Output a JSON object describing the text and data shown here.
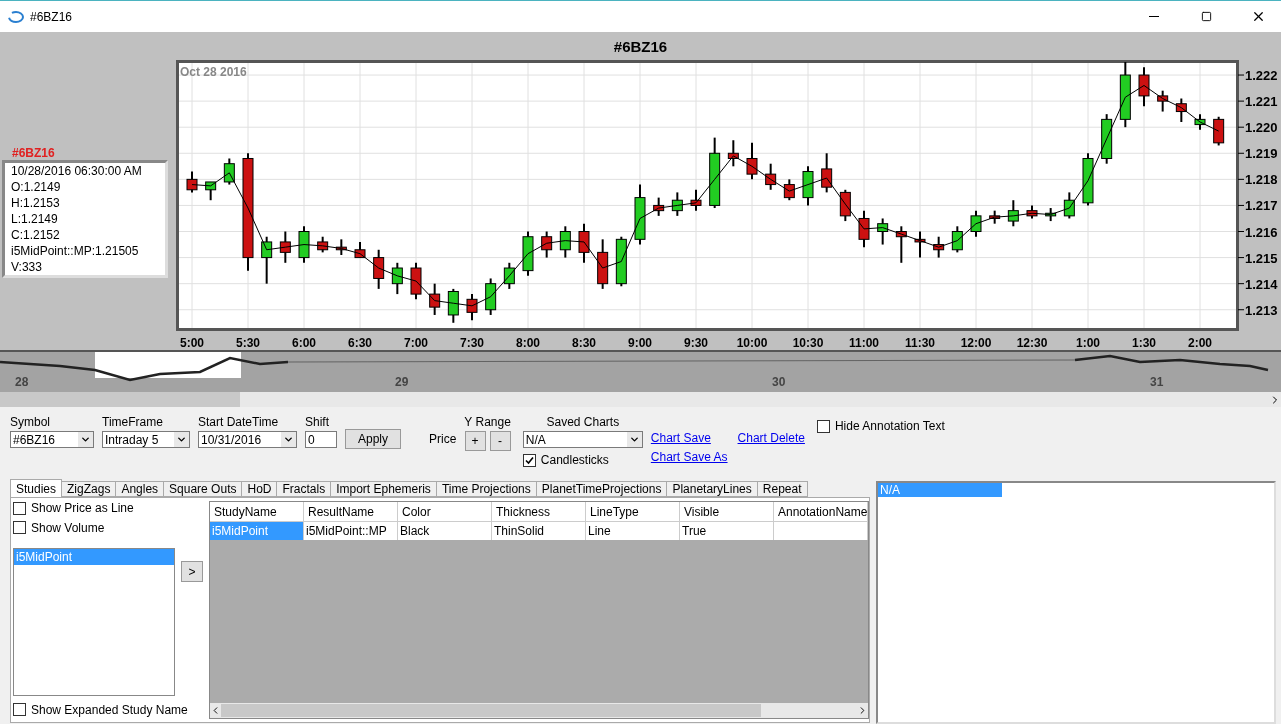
{
  "window": {
    "title": "#6BZ16"
  },
  "chart": {
    "title": "#6BZ16",
    "date_label": "Oct 28 2016",
    "info": {
      "symbol": "#6BZ16",
      "lines": [
        "10/28/2016 06:30:00 AM",
        "O:1.2149",
        "H:1.2153",
        "L:1.2149",
        "C:1.2152",
        "i5MidPoint::MP:1.21505",
        "V:333"
      ]
    },
    "chart_data": {
      "type": "candlestick",
      "grid": true,
      "categories": [
        "5:00",
        null,
        null,
        "5:30",
        null,
        null,
        "6:00",
        null,
        null,
        "6:30",
        null,
        null,
        "7:00",
        null,
        null,
        "7:30",
        null,
        null,
        "8:00",
        null,
        null,
        "8:30",
        null,
        null,
        "9:00",
        null,
        null,
        "9:30",
        null,
        null,
        "10:00",
        null,
        null,
        "10:30",
        null,
        null,
        "11:00",
        null,
        null,
        "11:30",
        null,
        null,
        "12:00",
        null,
        null,
        "12:30",
        null,
        null,
        "1:00",
        null,
        null,
        "1:30",
        null,
        null,
        "2:00",
        null
      ],
      "ohlc": [
        [
          1.218,
          1.2183,
          1.2175,
          1.2176
        ],
        [
          1.2176,
          1.2179,
          1.2172,
          1.2179
        ],
        [
          1.2179,
          1.2188,
          1.2178,
          1.2186
        ],
        [
          1.2188,
          1.219,
          1.2145,
          1.215
        ],
        [
          1.215,
          1.2158,
          1.214,
          1.2156
        ],
        [
          1.2156,
          1.216,
          1.2148,
          1.2152
        ],
        [
          1.215,
          1.2162,
          1.2148,
          1.216
        ],
        [
          1.2156,
          1.2158,
          1.2152,
          1.2153
        ],
        [
          1.2154,
          1.2157,
          1.2151,
          1.2153
        ],
        [
          1.2153,
          1.2156,
          1.215,
          1.215
        ],
        [
          1.215,
          1.2153,
          1.2138,
          1.2142
        ],
        [
          1.214,
          1.2148,
          1.2136,
          1.2146
        ],
        [
          1.2146,
          1.2148,
          1.2134,
          1.2136
        ],
        [
          1.2136,
          1.214,
          1.2128,
          1.2131
        ],
        [
          1.2128,
          1.2138,
          1.2125,
          1.2137
        ],
        [
          1.2134,
          1.2136,
          1.2126,
          1.2129
        ],
        [
          1.213,
          1.2142,
          1.2128,
          1.214
        ],
        [
          1.214,
          1.2148,
          1.2138,
          1.2146
        ],
        [
          1.2145,
          1.216,
          1.2143,
          1.2158
        ],
        [
          1.2158,
          1.216,
          1.215,
          1.2153
        ],
        [
          1.2153,
          1.2162,
          1.215,
          1.216
        ],
        [
          1.216,
          1.2163,
          1.2148,
          1.2152
        ],
        [
          1.2152,
          1.2157,
          1.2138,
          1.214
        ],
        [
          1.214,
          1.2158,
          1.2139,
          1.2157
        ],
        [
          1.2157,
          1.2178,
          1.2155,
          1.2173
        ],
        [
          1.217,
          1.2173,
          1.2166,
          1.2168
        ],
        [
          1.2168,
          1.2175,
          1.2166,
          1.2172
        ],
        [
          1.2172,
          1.2176,
          1.2168,
          1.217
        ],
        [
          1.217,
          1.2196,
          1.2169,
          1.219
        ],
        [
          1.219,
          1.2195,
          1.2185,
          1.2188
        ],
        [
          1.2188,
          1.2194,
          1.218,
          1.2182
        ],
        [
          1.2182,
          1.2186,
          1.2176,
          1.2178
        ],
        [
          1.2178,
          1.218,
          1.2172,
          1.2173
        ],
        [
          1.2173,
          1.2185,
          1.217,
          1.2183
        ],
        [
          1.2184,
          1.219,
          1.2175,
          1.2177
        ],
        [
          1.2175,
          1.2176,
          1.2164,
          1.2166
        ],
        [
          1.2165,
          1.2168,
          1.2154,
          1.2157
        ],
        [
          1.216,
          1.2165,
          1.2155,
          1.2163
        ],
        [
          1.216,
          1.2162,
          1.2148,
          1.2158
        ],
        [
          1.2157,
          1.216,
          1.215,
          1.2156
        ],
        [
          1.2155,
          1.2158,
          1.215,
          1.2153
        ],
        [
          1.2153,
          1.2162,
          1.2152,
          1.216
        ],
        [
          1.216,
          1.2168,
          1.2158,
          1.2166
        ],
        [
          1.2166,
          1.2168,
          1.2163,
          1.2165
        ],
        [
          1.2164,
          1.2172,
          1.2162,
          1.2168
        ],
        [
          1.2168,
          1.217,
          1.2165,
          1.2166
        ],
        [
          1.2166,
          1.2169,
          1.2164,
          1.2167
        ],
        [
          1.2166,
          1.2175,
          1.2165,
          1.2172
        ],
        [
          1.2171,
          1.219,
          1.217,
          1.2188
        ],
        [
          1.2188,
          1.2205,
          1.2186,
          1.2203
        ],
        [
          1.2203,
          1.2225,
          1.22,
          1.222
        ],
        [
          1.222,
          1.2223,
          1.2208,
          1.2212
        ],
        [
          1.2212,
          1.2214,
          1.2206,
          1.221
        ],
        [
          1.2209,
          1.2211,
          1.2202,
          1.2206
        ],
        [
          1.2201,
          1.2205,
          1.2199,
          1.2203
        ],
        [
          1.2203,
          1.2204,
          1.2193,
          1.2194
        ]
      ],
      "series": [
        {
          "type": "line",
          "color": "#000000",
          "values": [
            1.2178,
            1.21775,
            1.21825,
            1.2169,
            1.2153,
            1.2154,
            1.2155,
            1.21545,
            1.21535,
            1.21515,
            1.2146,
            1.2143,
            1.2141,
            1.21335,
            1.21325,
            1.21315,
            1.2135,
            1.2143,
            1.21515,
            1.21555,
            1.21565,
            1.2156,
            1.2146,
            1.21485,
            1.2165,
            1.2169,
            1.217,
            1.2171,
            1.218,
            1.2189,
            1.2185,
            1.218,
            1.21755,
            1.2178,
            1.21805,
            1.21705,
            1.2161,
            1.21615,
            1.2159,
            1.21565,
            1.2154,
            1.21565,
            1.2163,
            1.21655,
            1.2166,
            1.2167,
            1.21665,
            1.2169,
            1.21795,
            1.21955,
            1.22115,
            1.2216,
            1.2211,
            1.22075,
            1.2202,
            1.21985
          ]
        }
      ],
      "ylim": [
        1.2123,
        1.2225
      ],
      "yticks": [
        {
          "value": 1.222,
          "label": "1.222"
        },
        {
          "value": 1.221,
          "label": "1.221"
        },
        {
          "value": 1.22,
          "label": "1.220"
        },
        {
          "value": 1.219,
          "label": "1.219"
        },
        {
          "value": 1.218,
          "label": "1.218"
        },
        {
          "value": 1.217,
          "label": "1.217"
        },
        {
          "value": 1.216,
          "label": "1.216"
        },
        {
          "value": 1.215,
          "label": "1.215"
        },
        {
          "value": 1.214,
          "label": "1.214"
        },
        {
          "value": 1.213,
          "label": "1.213"
        }
      ]
    },
    "overview": {
      "day_labels": [
        "28",
        "29",
        "30",
        "31"
      ]
    }
  },
  "controls": {
    "symbol": {
      "label": "Symbol",
      "value": "#6BZ16"
    },
    "timeframe": {
      "label": "TimeFrame",
      "value": "Intraday 5"
    },
    "start_datetime": {
      "label": "Start DateTime",
      "value": "10/31/2016"
    },
    "shift": {
      "label": "Shift",
      "value": "0"
    },
    "apply_button": "Apply",
    "price_label": "Price",
    "y_range": {
      "label": "Y Range",
      "buttons": [
        "+",
        "-"
      ]
    },
    "saved_charts": {
      "label": "Saved Charts",
      "value": "N/A"
    },
    "candlesticks": {
      "label": "Candlesticks",
      "checked": true
    },
    "links": [
      "Chart Save",
      "Chart Save As",
      "Chart Delete"
    ],
    "hide_annotation": {
      "label": "Hide Annotation Text",
      "checked": false
    }
  },
  "tabs": [
    {
      "label": "Studies",
      "selected": true
    },
    {
      "label": "ZigZags",
      "selected": false
    },
    {
      "label": "Angles",
      "selected": false
    },
    {
      "label": "Square Outs",
      "selected": false
    },
    {
      "label": "HoD",
      "selected": false
    },
    {
      "label": "Fractals",
      "selected": false
    },
    {
      "label": "Import Ephemeris",
      "selected": false
    },
    {
      "label": "Time Projections",
      "selected": false
    },
    {
      "label": "PlanetTimeProjections",
      "selected": false
    },
    {
      "label": "PlanetaryLines",
      "selected": false
    },
    {
      "label": "Repeat",
      "selected": false
    }
  ],
  "studies": {
    "options": [
      {
        "label": "Show Price as Line",
        "checked": false
      },
      {
        "label": "Show Volume",
        "checked": false
      }
    ],
    "list": [
      {
        "label": "i5MidPoint",
        "selected": true
      }
    ],
    "add_button": ">",
    "expanded_option": {
      "label": "Show Expanded Study Name",
      "checked": false
    }
  },
  "table": {
    "columns": [
      "StudyName",
      "ResultName",
      "Color",
      "Thickness",
      "LineType",
      "Visible",
      "AnnotationName"
    ],
    "rows": [
      {
        "cells": [
          {
            "text": "i5MidPoint",
            "selected": true
          },
          {
            "text": "i5MidPoint::MP",
            "selected": false
          },
          {
            "text": "Black",
            "selected": false
          },
          {
            "text": "ThinSolid",
            "selected": false
          },
          {
            "text": "Line",
            "selected": false
          },
          {
            "text": "True",
            "selected": false
          }
        ]
      }
    ]
  },
  "annotations": {
    "items": [
      {
        "label": "N/A",
        "selected": true
      }
    ]
  }
}
